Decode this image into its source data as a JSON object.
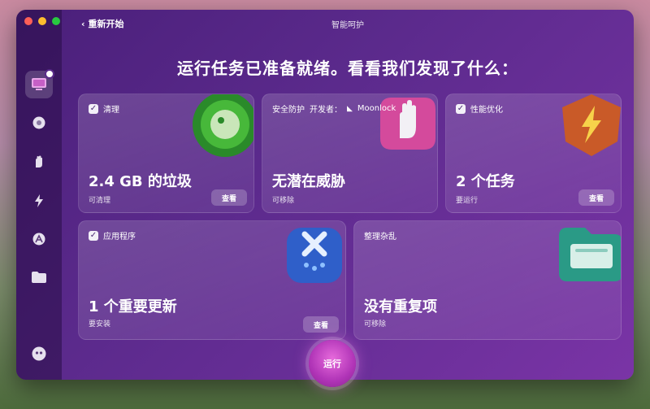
{
  "window": {
    "title": "智能呵护",
    "back_label": "重新开始"
  },
  "headline": "运行任务已准备就绪。看看我们发现了什么：",
  "cards": {
    "cleanup": {
      "label": "清理",
      "value": "2.4 GB 的垃圾",
      "sub": "可清理",
      "button": "查看"
    },
    "protection": {
      "label": "安全防护",
      "developer_label": "开发者：",
      "developer": "Moonlock",
      "value": "无潜在威胁",
      "sub": "可移除"
    },
    "performance": {
      "label": "性能优化",
      "value": "2 个任务",
      "sub": "要运行",
      "button": "查看"
    },
    "applications": {
      "label": "应用程序",
      "value": "1 个重要更新",
      "sub": "要安装",
      "button": "查看"
    },
    "clutter": {
      "label": "整理杂乱",
      "value": "没有重复项",
      "sub": "可移除"
    }
  },
  "run_button": "运行",
  "sidebar": {
    "items": [
      "smart-care-icon",
      "cleanup-icon",
      "protection-icon",
      "performance-icon",
      "applications-icon",
      "files-icon",
      "assistant-icon"
    ]
  }
}
